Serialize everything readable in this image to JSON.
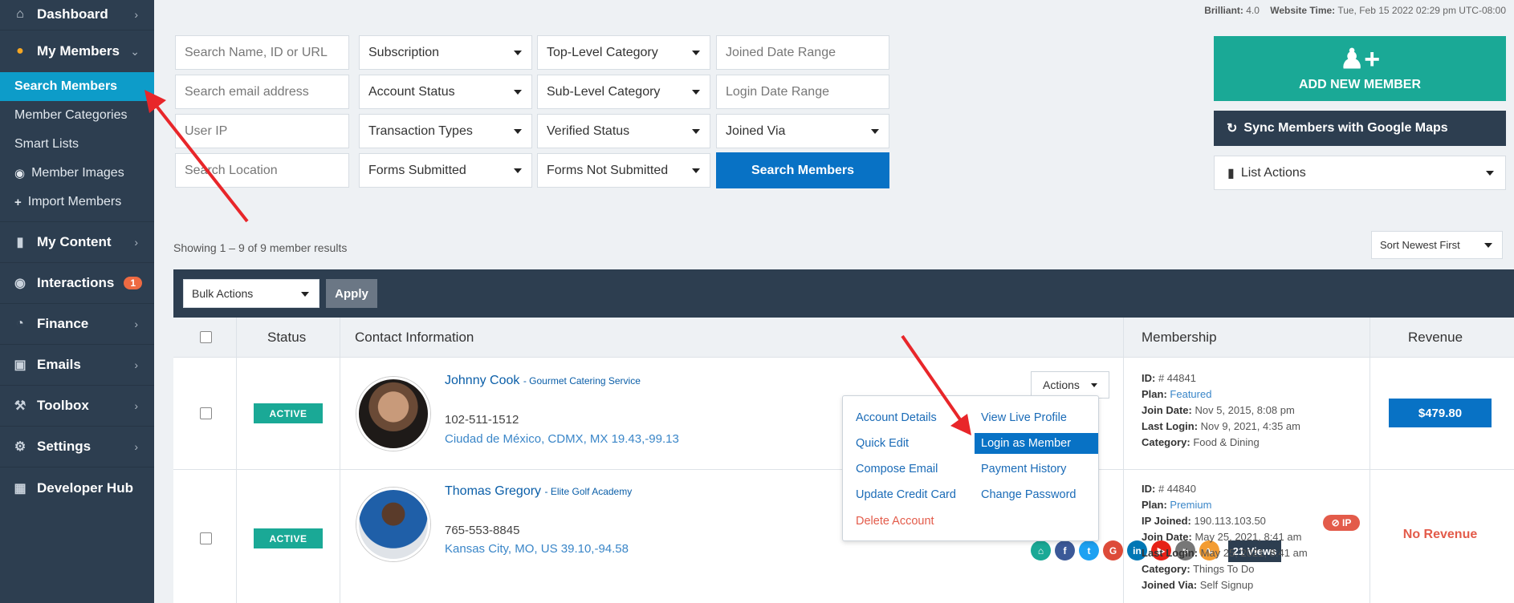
{
  "top_info": {
    "brilliant_label": "Brilliant:",
    "brilliant_value": "4.0",
    "time_label": "Website Time:",
    "time_value": "Tue, Feb 15 2022 02:29 pm UTC-08:00"
  },
  "sidebar": {
    "dashboard": "Dashboard",
    "my_members": "My Members",
    "sub_items": {
      "search_members": "Search Members",
      "member_categories": "Member Categories",
      "smart_lists": "Smart Lists",
      "member_images": "Member Images",
      "import_members": "Import Members"
    },
    "my_content": "My Content",
    "interactions": "Interactions",
    "interactions_badge": "1",
    "finance": "Finance",
    "emails": "Emails",
    "toolbox": "Toolbox",
    "settings": "Settings",
    "developer_hub": "Developer Hub"
  },
  "filters": {
    "search_name": "Search Name, ID or URL",
    "search_email": "Search email address",
    "user_ip": "User IP",
    "search_location": "Search Location",
    "subscription": "Subscription",
    "account_status": "Account Status",
    "transaction_types": "Transaction Types",
    "forms_submitted": "Forms Submitted",
    "top_level_category": "Top-Level Category",
    "sub_level_category": "Sub-Level Category",
    "verified_status": "Verified Status",
    "forms_not_submitted": "Forms Not Submitted",
    "joined_date_range": "Joined Date Range",
    "login_date_range": "Login Date Range",
    "joined_via": "Joined Via",
    "search_button": "Search Members"
  },
  "right_panel": {
    "add_new_member": "ADD NEW MEMBER",
    "sync_google_maps": "Sync Members with Google Maps",
    "list_actions": "List Actions"
  },
  "results": {
    "count_text": "Showing 1 – 9 of 9 member results",
    "sort": "Sort Newest First"
  },
  "bulk": {
    "bulk_actions": "Bulk Actions",
    "apply": "Apply"
  },
  "table": {
    "headers": {
      "status": "Status",
      "contact": "Contact Information",
      "membership": "Membership",
      "revenue": "Revenue"
    },
    "rows": [
      {
        "status": "ACTIVE",
        "name": "Johnny Cook",
        "company": "- Gourmet Catering Service",
        "phone": "102-511-1512",
        "location": "Ciudad de México, CDMX, MX   19.43,-99.13",
        "actions": "Actions",
        "id_label": "ID:",
        "id_value": "# 44841",
        "plan_label": "Plan:",
        "plan_value": "Featured",
        "join_label": "Join Date:",
        "join_value": "Nov 5, 2015, 8:08 pm",
        "login_label": "Last Login:",
        "login_value": "Nov 9, 2021, 4:35 am",
        "category_label": "Category:",
        "category_value": "Food & Dining",
        "revenue": "$479.80"
      },
      {
        "status": "ACTIVE",
        "name": "Thomas Gregory",
        "company": "- Elite Golf Academy",
        "phone": "765-553-8845",
        "location": "Kansas City, MO, US   39.10,-94.58",
        "views": "21 Views",
        "id_label": "ID:",
        "id_value": "# 44840",
        "plan_label": "Plan:",
        "plan_value": "Premium",
        "ip_label": "IP Joined:",
        "ip_value": "190.113.103.50",
        "ip_badge": "⊘ IP",
        "join_label": "Join Date:",
        "join_value": "May 25, 2021, 8:41 am",
        "login_label": "Last Login:",
        "login_value": "May 25, 2021, 8:41 am",
        "category_label": "Category:",
        "category_value": "Things To Do",
        "joined_via_label": "Joined Via:",
        "joined_via_value": "Self Signup",
        "revenue": "No Revenue"
      }
    ]
  },
  "dropdown": {
    "account_details": "Account Details",
    "view_live_profile": "View Live Profile",
    "quick_edit": "Quick Edit",
    "login_as_member": "Login as Member",
    "compose_email": "Compose Email",
    "payment_history": "Payment History",
    "update_credit_card": "Update Credit Card",
    "change_password": "Change Password",
    "delete_account": "Delete Account"
  },
  "socials": [
    "home-icon",
    "facebook-icon",
    "twitter-icon",
    "google-plus-icon",
    "linkedin-icon",
    "youtube-icon",
    "pinterest-icon",
    "rss-icon"
  ],
  "colors": {
    "sidebar_bg": "#2d3e50",
    "active_blue": "#0d9cc9",
    "primary_blue": "#0872c5",
    "teal": "#1aa996",
    "danger": "#e35b4a",
    "arrow_red": "#e8262a"
  }
}
